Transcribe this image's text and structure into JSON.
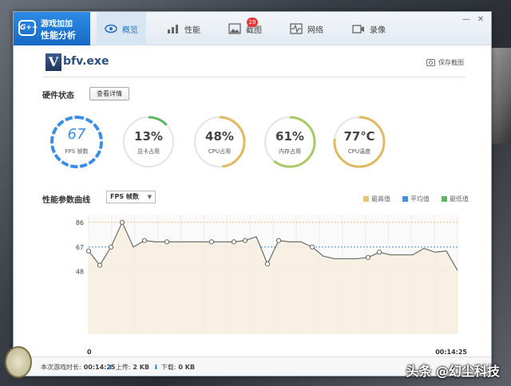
{
  "app": {
    "logo_line1": "游戏加加",
    "logo_line2": "性能分析",
    "logo_mark": "G++"
  },
  "tabs": [
    {
      "label": "概览",
      "icon": "eye-icon",
      "active": true
    },
    {
      "label": "性能",
      "icon": "bar-chart-icon"
    },
    {
      "label": "截图",
      "icon": "image-icon",
      "badge": "19"
    },
    {
      "label": "网络",
      "icon": "pulse-icon"
    },
    {
      "label": "录像",
      "icon": "video-icon"
    }
  ],
  "window_controls": {
    "minimize": "—",
    "close": "✕"
  },
  "process": {
    "name": "bfv.exe",
    "icon_letter": "V",
    "save_screenshot": "保存截图"
  },
  "hardware": {
    "title": "硬件状态",
    "detail_button": "查看详情",
    "gauges": [
      {
        "value": "67",
        "label": "FPS 帧数",
        "type": "fps",
        "fraction": 0.67,
        "color": "#3a8ee6"
      },
      {
        "value": "13%",
        "label": "显卡占用",
        "fraction": 0.13,
        "color": "#5cb85c"
      },
      {
        "value": "48%",
        "label": "CPU占用",
        "fraction": 0.48,
        "color": "#e0b860"
      },
      {
        "value": "61%",
        "label": "内存占用",
        "fraction": 0.61,
        "color": "#a8c864"
      },
      {
        "value": "77℃",
        "label": "CPU温度",
        "fraction": 0.77,
        "color": "#e0b860"
      }
    ]
  },
  "curve": {
    "title": "性能参数曲线",
    "metric": "FPS 帧数",
    "legend": [
      {
        "label": "最高值",
        "color": "#e6c27a"
      },
      {
        "label": "平均值",
        "color": "#4a90d9"
      },
      {
        "label": "最低值",
        "color": "#5cb85c"
      }
    ]
  },
  "chart_data": {
    "type": "line",
    "y_ticks": [
      86,
      67,
      48
    ],
    "max": 86,
    "avg": 67,
    "min": 48,
    "ylim": [
      0,
      92
    ],
    "x_start_label": "0",
    "x_end_label": "00:14:25",
    "values": [
      64,
      53,
      67,
      86,
      67,
      72,
      71,
      71,
      71,
      71,
      71,
      71,
      71,
      71,
      72,
      75,
      54,
      72,
      71,
      71,
      67,
      60,
      58,
      58,
      58,
      59,
      63,
      61,
      61,
      61,
      66,
      63,
      64,
      49
    ],
    "markers": [
      0,
      1,
      2,
      3,
      5,
      7,
      11,
      13,
      14,
      16,
      17,
      20,
      25,
      26
    ]
  },
  "status": {
    "duration_label": "本次游戏时长:",
    "duration": "00:14:25",
    "upload_label": "上传:",
    "upload": "2 KB",
    "download_label": "下载:",
    "download": "0 KB"
  },
  "overlay": {
    "watermark": "头条 @幻尘科技"
  }
}
